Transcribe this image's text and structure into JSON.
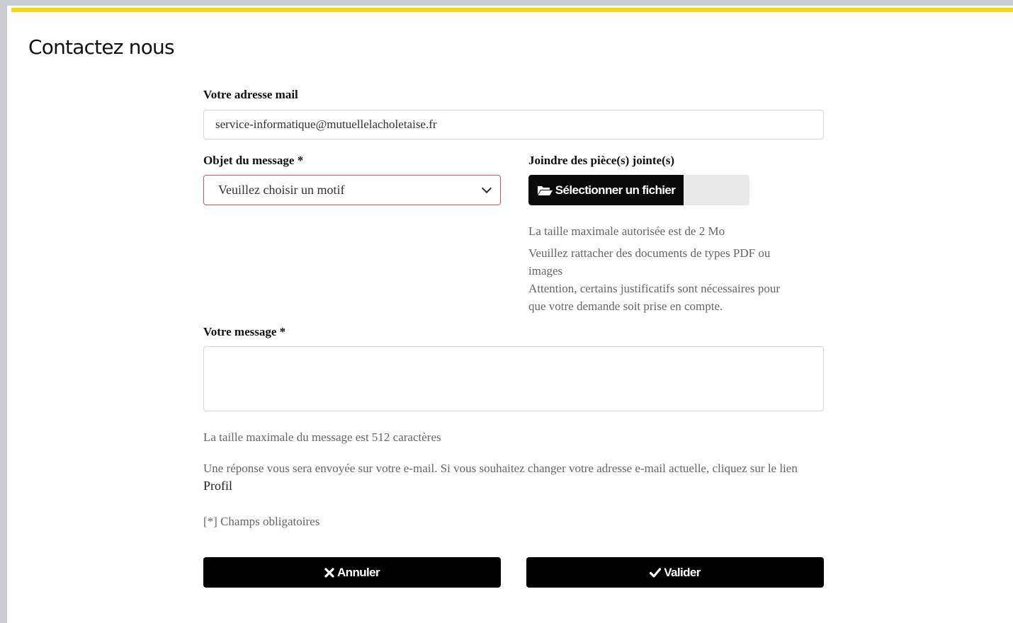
{
  "page": {
    "title": "Contactez nous"
  },
  "colors": {
    "accent": "#f4d90f",
    "error_border": "#d9534f",
    "button_bg": "#000000"
  },
  "form": {
    "email": {
      "label": "Votre adresse mail",
      "value": "service-informatique@mutuellelacholetaise.fr"
    },
    "subject": {
      "label": "Objet du message *",
      "selected": "Veuillez choisir un motif"
    },
    "attachment": {
      "label": "Joindre des pièce(s) jointe(s)",
      "button_label": "Sélectionner un fichier",
      "icon": "folder-open-icon",
      "help_size": "La taille maximale autorisée est de 2 Mo",
      "help_types": "Veuillez rattacher des documents de types PDF ou images",
      "help_attention": "Attention, certains justificatifs sont nécessaires pour que votre demande soit prise en compte."
    },
    "message": {
      "label": "Votre message *",
      "value": "",
      "max_info": "La taille maximale du message est 512 caractères"
    },
    "reply_info": "Une réponse vous sera envoyée sur votre e-mail. Si vous souhaitez changer votre adresse e-mail actuelle, cliquez sur le lien",
    "profile_link": "Profil",
    "required_note": "[*] Champs obligatoires"
  },
  "actions": {
    "cancel": {
      "label": "Annuler",
      "icon": "times-icon"
    },
    "submit": {
      "label": "Valider",
      "icon": "check-icon"
    }
  }
}
